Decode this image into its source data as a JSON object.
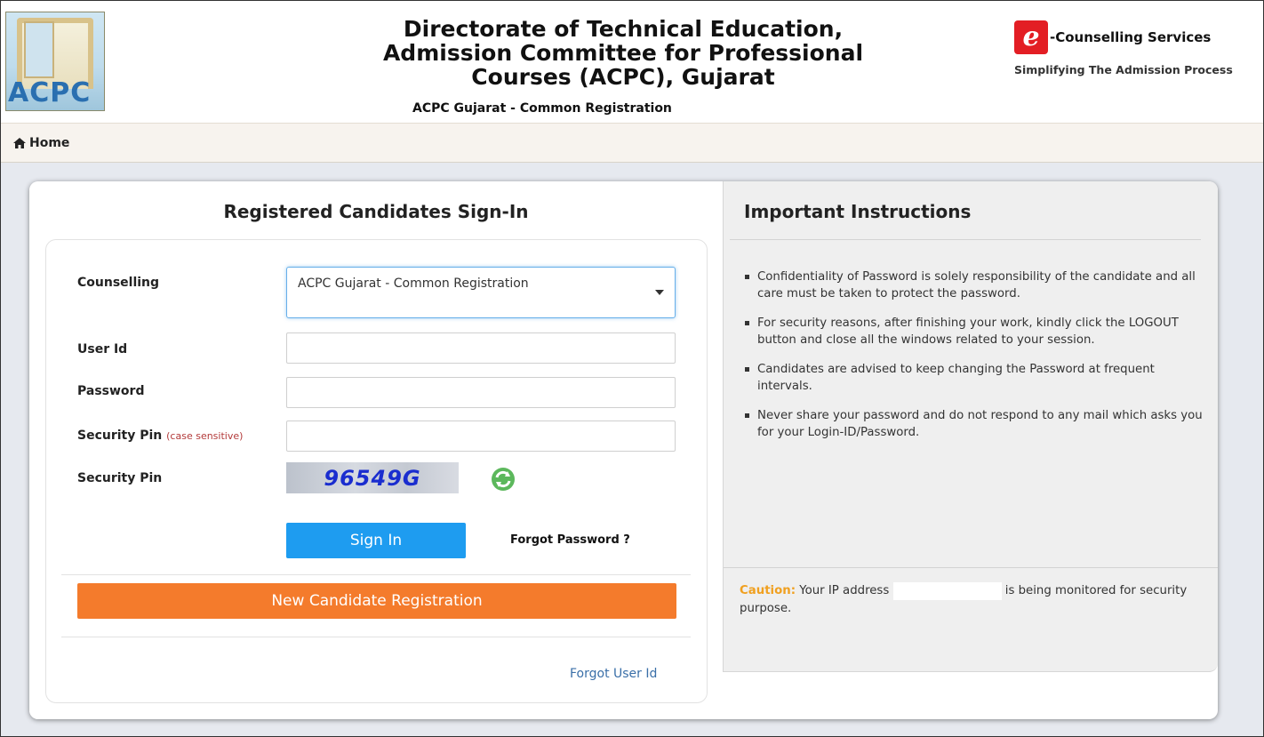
{
  "header": {
    "logo_text": "ACPC",
    "title_line1": "Directorate of Technical Education,",
    "title_line2": "Admission Committee for Professional",
    "title_line3": "Courses (ACPC), Gujarat",
    "subtitle": "ACPC Gujarat - Common Registration",
    "ecounselling_title": "-Counselling Services",
    "ecounselling_tagline": "Simplifying The Admission Process"
  },
  "nav": {
    "home_label": "Home",
    "home_icon": "home-icon"
  },
  "signin": {
    "title": "Registered Candidates Sign-In",
    "counselling_label": "Counselling",
    "counselling_selected": "ACPC Gujarat - Common Registration",
    "userid_label": "User Id",
    "userid_value": "",
    "password_label": "Password",
    "password_value": "",
    "security_pin_input_label": "Security Pin",
    "security_pin_hint": "(case sensitive)",
    "security_pin_value": "",
    "security_pin_image_label": "Security Pin",
    "captcha_text": "96549G",
    "refresh_icon": "refresh-icon",
    "signin_button": "Sign In",
    "forgot_password": "Forgot Password ?",
    "new_registration_button": "New Candidate Registration",
    "forgot_userid": "Forgot User Id"
  },
  "instructions": {
    "title": "Important Instructions",
    "items": [
      "Confidentiality of Password is solely responsibility of the candidate and all care must be taken to protect the password.",
      "For security reasons, after finishing your work, kindly click the LOGOUT button and close all the windows related to your session.",
      "Candidates are advised to keep changing the Password at frequent intervals.",
      "Never share your password and do not respond to any mail which asks you for your Login-ID/Password."
    ],
    "caution_label": "Caution:",
    "caution_before_ip": "Your IP address",
    "caution_after_ip": "is being monitored for security purpose."
  },
  "colors": {
    "signin_button": "#1e9cf0",
    "register_button": "#f47b2c",
    "caution": "#f0a020",
    "ecounselling_red": "#e31e24"
  }
}
